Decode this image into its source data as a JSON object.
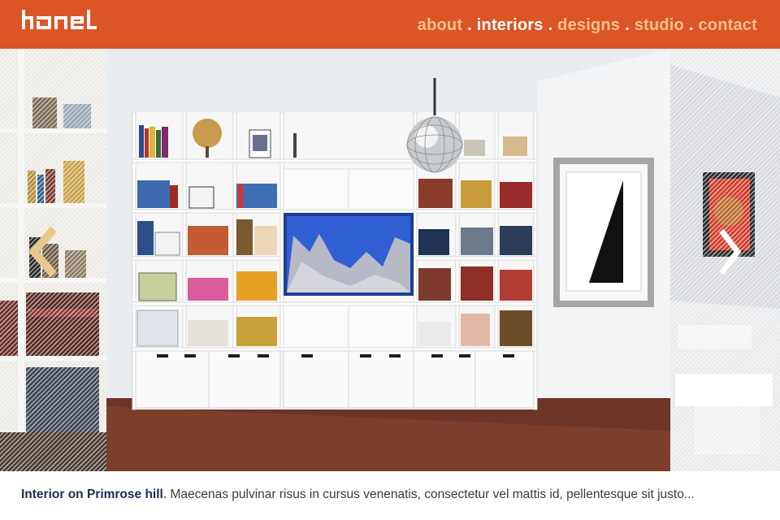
{
  "brand": {
    "logo_text": "hanel",
    "accent_color": "#dc5526"
  },
  "nav": {
    "items": [
      {
        "label": "about",
        "active": false
      },
      {
        "label": "interiors",
        "active": true
      },
      {
        "label": "designs",
        "active": false
      },
      {
        "label": "studio",
        "active": false
      },
      {
        "label": "contact",
        "active": false
      }
    ],
    "separator": "."
  },
  "gallery": {
    "prev_icon": "chevron-left-icon",
    "next_icon": "chevron-right-icon"
  },
  "caption": {
    "title": "Interior on Primrose hill",
    "dot": ".",
    "text": " Maecenas pulvinar risus in cursus venenatis, consectetur vel mattis id, pellentesque sit justo..."
  }
}
